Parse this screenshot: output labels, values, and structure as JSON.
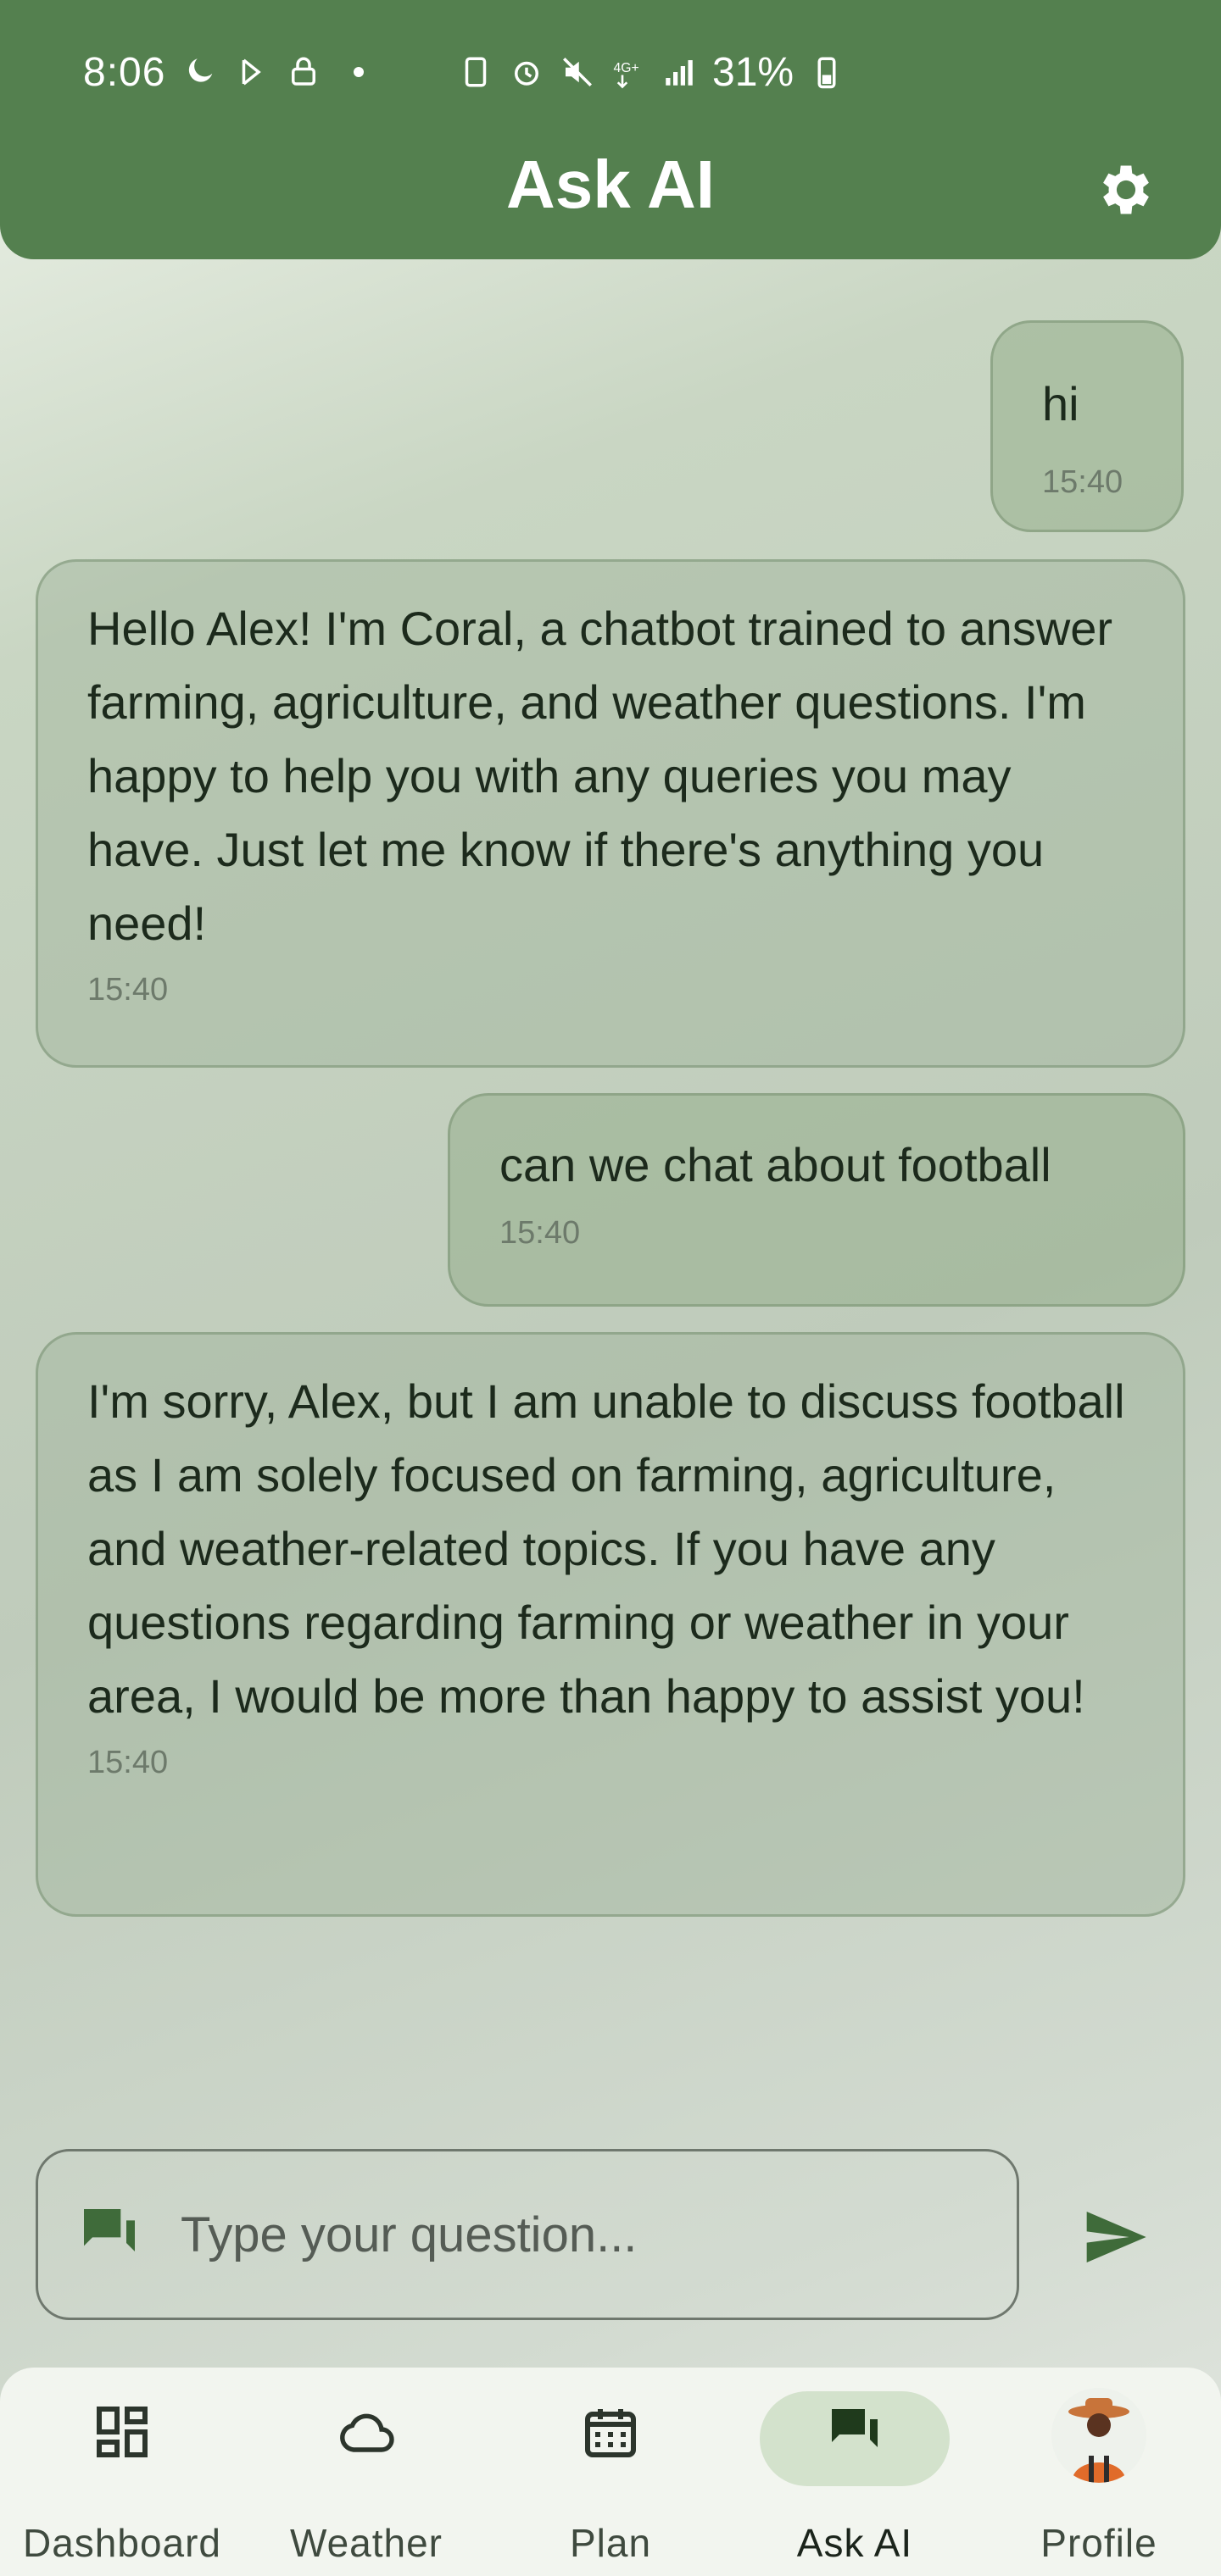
{
  "status_bar": {
    "time": "8:06",
    "battery": "31%"
  },
  "header": {
    "title": "Ask AI"
  },
  "messages": [
    {
      "role": "user",
      "text": "hi",
      "time": "15:40"
    },
    {
      "role": "assistant",
      "text": "Hello Alex! I'm Coral, a chatbot trained to answer farming, agriculture, and weather questions. I'm happy to help you with any queries you may have. Just let me know if there's anything you need!",
      "time": "15:40"
    },
    {
      "role": "user",
      "text": "can we chat about football",
      "time": "15:40"
    },
    {
      "role": "assistant",
      "text": "I'm sorry, Alex, but I am unable to discuss football as I am solely focused on farming, agriculture, and weather-related topics. If you have any questions regarding farming or weather in your area, I would be more than happy to assist you!",
      "time": "15:40"
    }
  ],
  "input": {
    "placeholder": "Type your question..."
  },
  "nav": {
    "items": [
      {
        "label": "Dashboard",
        "icon": "dashboard-icon"
      },
      {
        "label": "Weather",
        "icon": "cloud-icon"
      },
      {
        "label": "Plan",
        "icon": "calendar-icon"
      },
      {
        "label": "Ask AI",
        "icon": "chat-icon",
        "active": true
      },
      {
        "label": "Profile",
        "icon": "avatar"
      }
    ]
  },
  "colors": {
    "header": "#54804f",
    "accent": "#3f6b3a",
    "active_pill": "#d3e2cc"
  }
}
